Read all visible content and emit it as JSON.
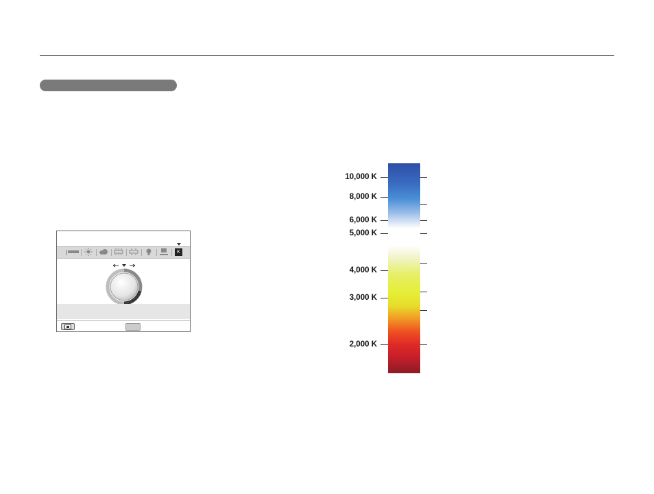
{
  "scale": {
    "labels": [
      "10,000 K",
      "8,000 K",
      "6,000 K",
      "5,000 K",
      "4,000 K",
      "3,000 K",
      "2,000 K"
    ]
  },
  "camera_screen": {
    "wb_icons": [
      "awb-icon",
      "daylight-icon",
      "cloudy-icon",
      "fluorescent-h-icon",
      "fluorescent-l-icon",
      "tungsten-icon",
      "custom-icon",
      "color-temperature-icon"
    ],
    "selected": "color-temperature-icon"
  },
  "colors": {
    "pill": "#7a7a7a",
    "rule": "#222222"
  }
}
